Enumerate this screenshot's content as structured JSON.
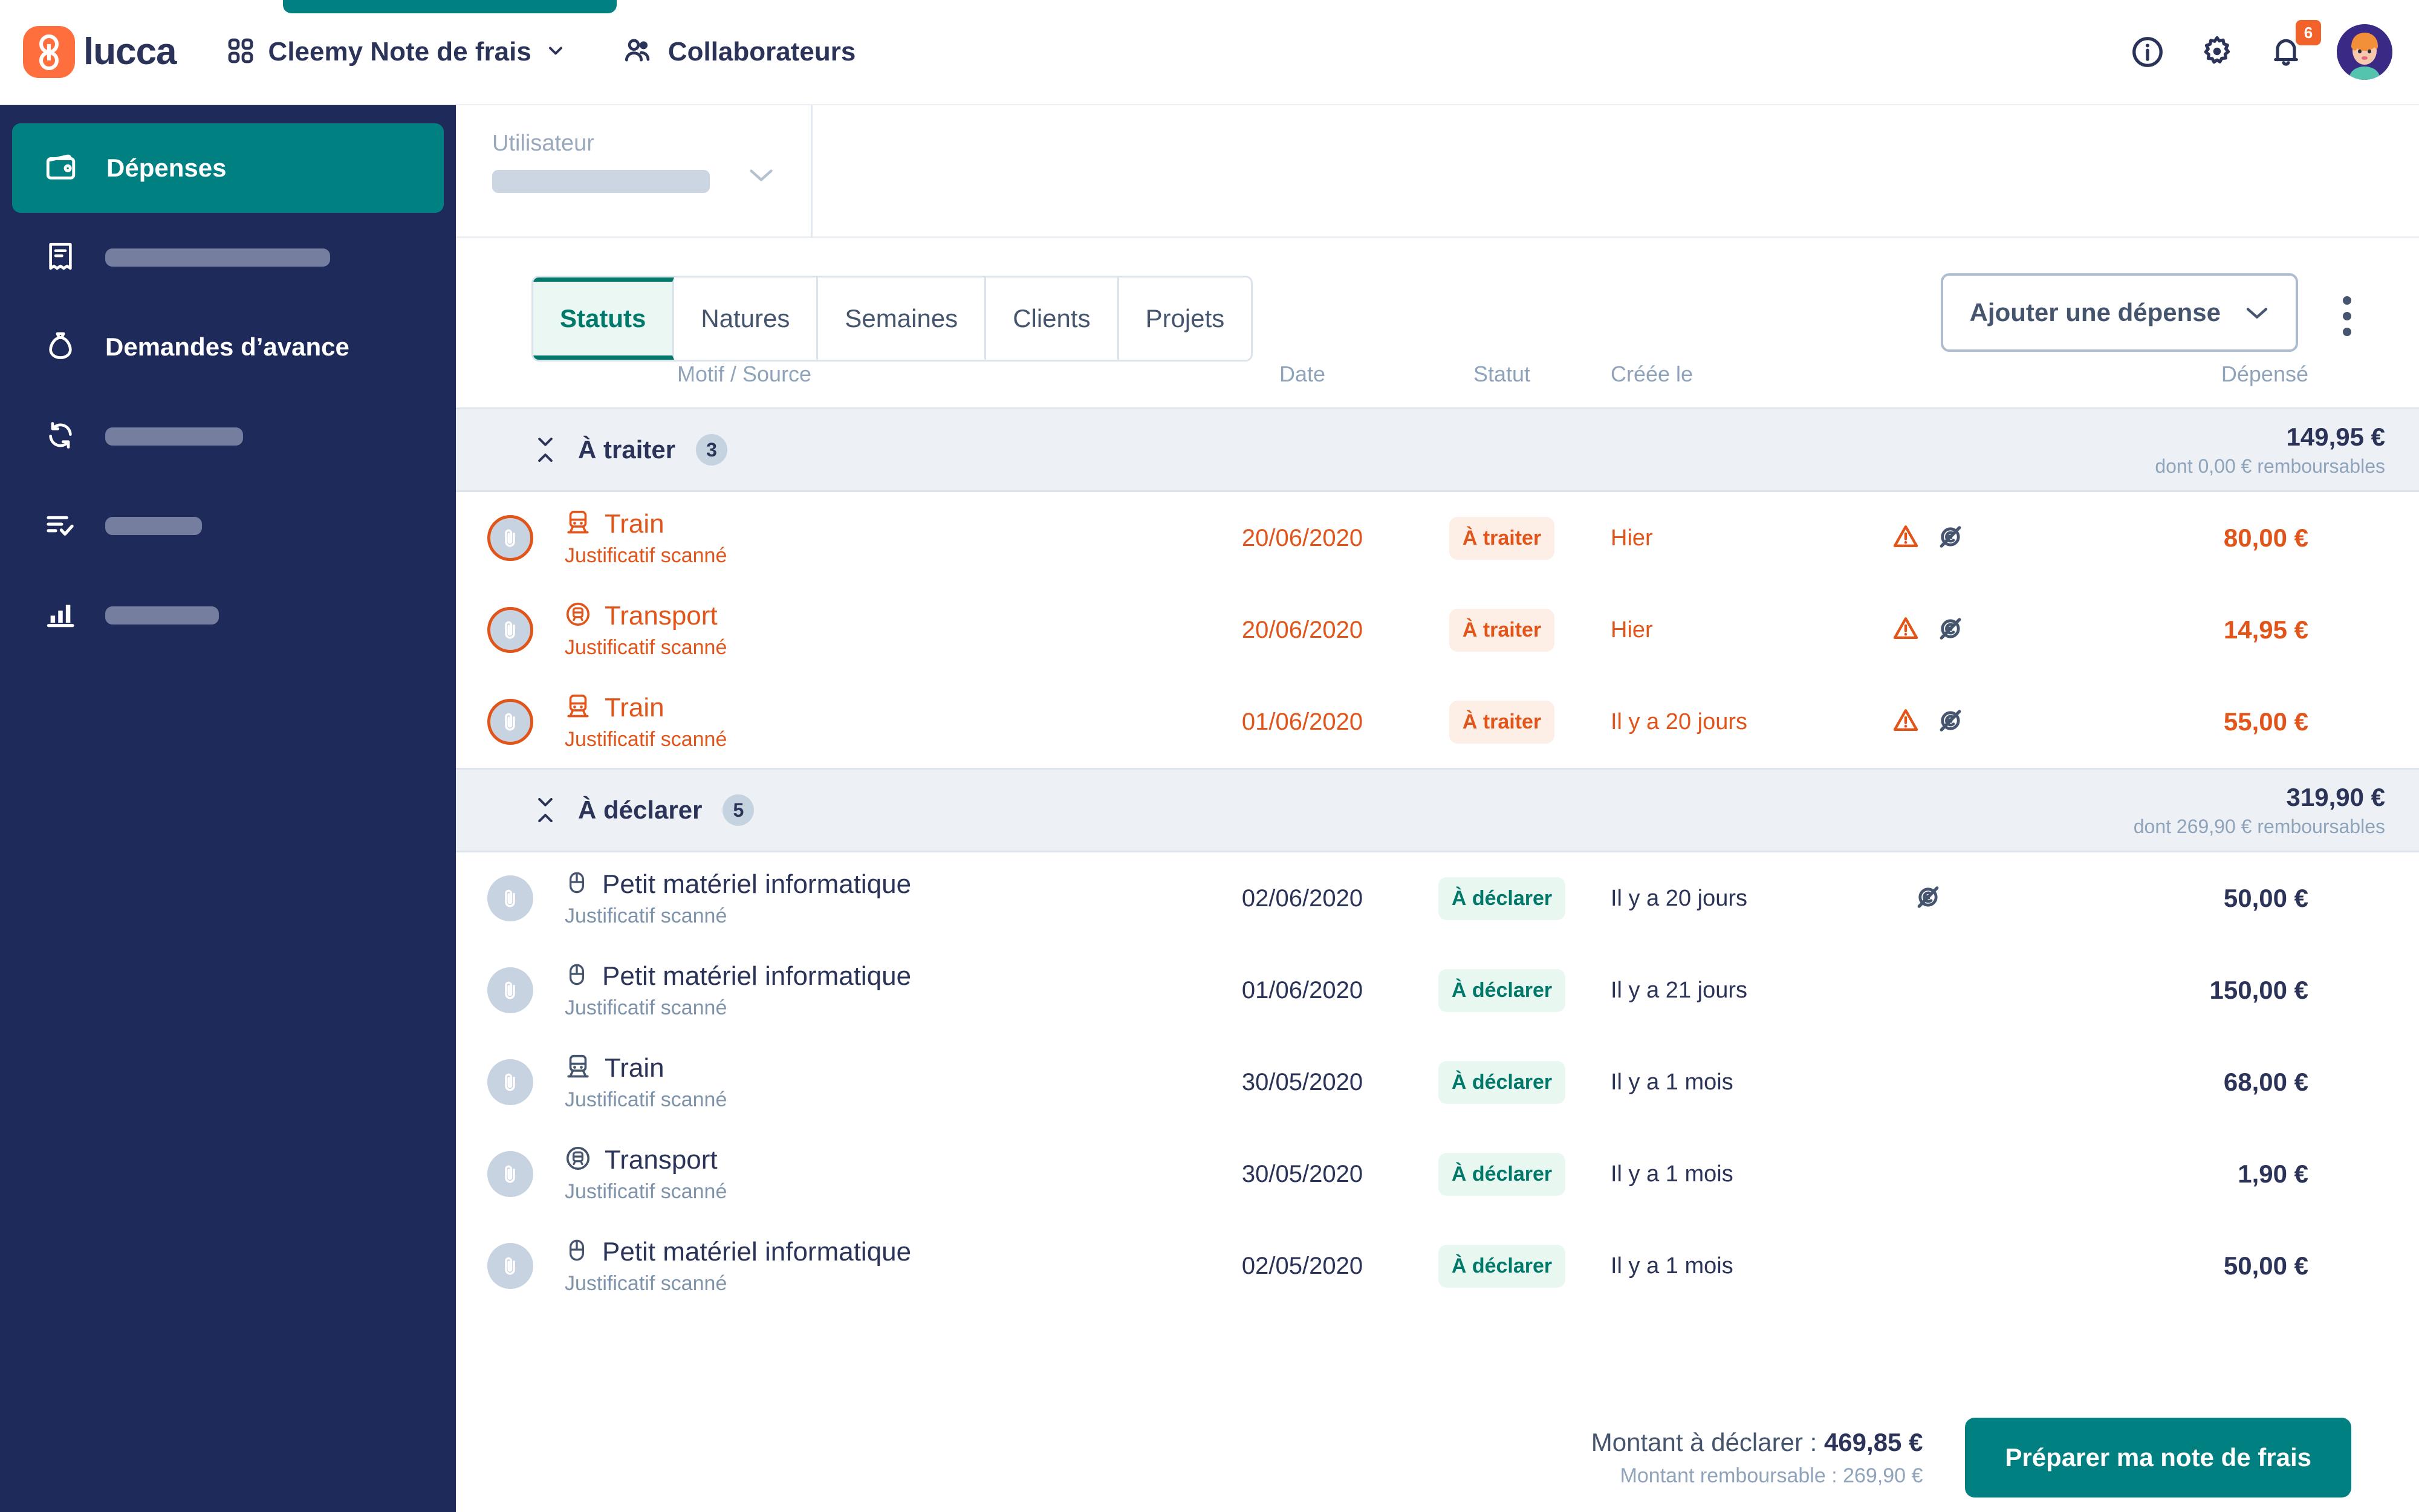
{
  "header": {
    "brand": "lucca",
    "app_switcher_icon": "grid-icon",
    "app_title": "Cleemy Note de frais",
    "app_title_chevron": "chevron-down-icon",
    "collaborateurs_label": "Collaborateurs",
    "collaborateurs_icon": "users-icon",
    "info_icon": "info-circle-icon",
    "settings_icon": "gear-icon",
    "notifications_icon": "bell-icon",
    "notifications_count": "6",
    "avatar": "user-avatar",
    "accent_teal": "#008080",
    "brand_orange": "#ff6f3d",
    "navy": "#2b3458"
  },
  "sidebar": {
    "items": [
      {
        "label": "Dépenses",
        "icon": "wallet-icon",
        "active": true,
        "placeholder_width": 0
      },
      {
        "label": "",
        "icon": "receipt-icon",
        "active": false,
        "placeholder_width": 372
      },
      {
        "label": "Demandes d’avance",
        "icon": "money-bag-icon",
        "active": false,
        "placeholder_width": 0
      },
      {
        "label": "",
        "icon": "refresh-icon",
        "active": false,
        "placeholder_width": 228
      },
      {
        "label": "",
        "icon": "checklist-icon",
        "active": false,
        "placeholder_width": 160
      },
      {
        "label": "",
        "icon": "bar-chart-icon",
        "active": false,
        "placeholder_width": 188
      }
    ]
  },
  "filters": {
    "user": {
      "label": "Utilisateur",
      "value": "",
      "chevron": "chevron-down-icon"
    }
  },
  "toolbar": {
    "tabs": [
      {
        "label": "Statuts",
        "active": true
      },
      {
        "label": "Natures",
        "active": false
      },
      {
        "label": "Semaines",
        "active": false
      },
      {
        "label": "Clients",
        "active": false
      },
      {
        "label": "Projets",
        "active": false
      }
    ],
    "add_expense_label": "Ajouter une dépense",
    "add_expense_chevron": "chevron-down-icon",
    "more_menu_icon": "kebab-menu-icon"
  },
  "table": {
    "columns": {
      "motif": "Motif / Source",
      "date": "Date",
      "statut": "Statut",
      "creele": "Créée le",
      "depense": "Dépensé"
    },
    "groups": [
      {
        "title": "À traiter",
        "count": "3",
        "total": "149,95 €",
        "subtotal": "dont 0,00 € remboursables",
        "collapse_icon": "collapse-icon",
        "rows": [
          {
            "alert": true,
            "clip_icon": "paperclip-icon",
            "nature_icon": "train-icon",
            "nature": "Train",
            "source": "Justificatif scanné",
            "date": "20/06/2020",
            "status": "À traiter",
            "status_style": "orange",
            "created": "Hier",
            "flags": [
              "warning-triangle-icon",
              "no-refund-icon"
            ],
            "amount": "80,00 €"
          },
          {
            "alert": true,
            "clip_icon": "paperclip-icon",
            "nature_icon": "metro-icon",
            "nature": "Transport",
            "source": "Justificatif scanné",
            "date": "20/06/2020",
            "status": "À traiter",
            "status_style": "orange",
            "created": "Hier",
            "flags": [
              "warning-triangle-icon",
              "no-refund-icon"
            ],
            "amount": "14,95 €"
          },
          {
            "alert": true,
            "clip_icon": "paperclip-icon",
            "nature_icon": "train-icon",
            "nature": "Train",
            "source": "Justificatif scanné",
            "date": "01/06/2020",
            "status": "À traiter",
            "status_style": "orange",
            "created": "Il y a 20 jours",
            "flags": [
              "warning-triangle-icon",
              "no-refund-icon"
            ],
            "amount": "55,00 €"
          }
        ]
      },
      {
        "title": "À déclarer",
        "count": "5",
        "total": "319,90 €",
        "subtotal": "dont 269,90 € remboursables",
        "collapse_icon": "collapse-icon",
        "rows": [
          {
            "alert": false,
            "clip_icon": "paperclip-icon",
            "nature_icon": "mouse-icon",
            "nature": "Petit matériel informatique",
            "source": "Justificatif scanné",
            "date": "02/06/2020",
            "status": "À déclarer",
            "status_style": "green",
            "created": "Il y a 20 jours",
            "flags": [
              "no-refund-icon"
            ],
            "amount": "50,00 €"
          },
          {
            "alert": false,
            "clip_icon": "paperclip-icon",
            "nature_icon": "mouse-icon",
            "nature": "Petit matériel informatique",
            "source": "Justificatif scanné",
            "date": "01/06/2020",
            "status": "À déclarer",
            "status_style": "green",
            "created": "Il y a 21 jours",
            "flags": [],
            "amount": "150,00 €"
          },
          {
            "alert": false,
            "clip_icon": "paperclip-icon",
            "nature_icon": "train-icon",
            "nature": "Train",
            "source": "Justificatif scanné",
            "date": "30/05/2020",
            "status": "À déclarer",
            "status_style": "green",
            "created": "Il y a 1 mois",
            "flags": [],
            "amount": "68,00 €"
          },
          {
            "alert": false,
            "clip_icon": "paperclip-icon",
            "nature_icon": "metro-icon",
            "nature": "Transport",
            "source": "Justificatif scanné",
            "date": "30/05/2020",
            "status": "À déclarer",
            "status_style": "green",
            "created": "Il y a 1 mois",
            "flags": [],
            "amount": "1,90 €"
          },
          {
            "alert": false,
            "clip_icon": "paperclip-icon",
            "nature_icon": "mouse-icon",
            "nature": "Petit matériel informatique",
            "source": "Justificatif scanné",
            "date": "02/05/2020",
            "status": "À déclarer",
            "status_style": "green",
            "created": "Il y a 1 mois",
            "flags": [],
            "amount": "50,00 €"
          }
        ]
      }
    ]
  },
  "footer": {
    "amount_label": "Montant à déclarer : ",
    "amount_value": "469,85 €",
    "refund_line": "Montant remboursable : 269,90 €",
    "prepare_button": "Préparer ma note de frais"
  }
}
